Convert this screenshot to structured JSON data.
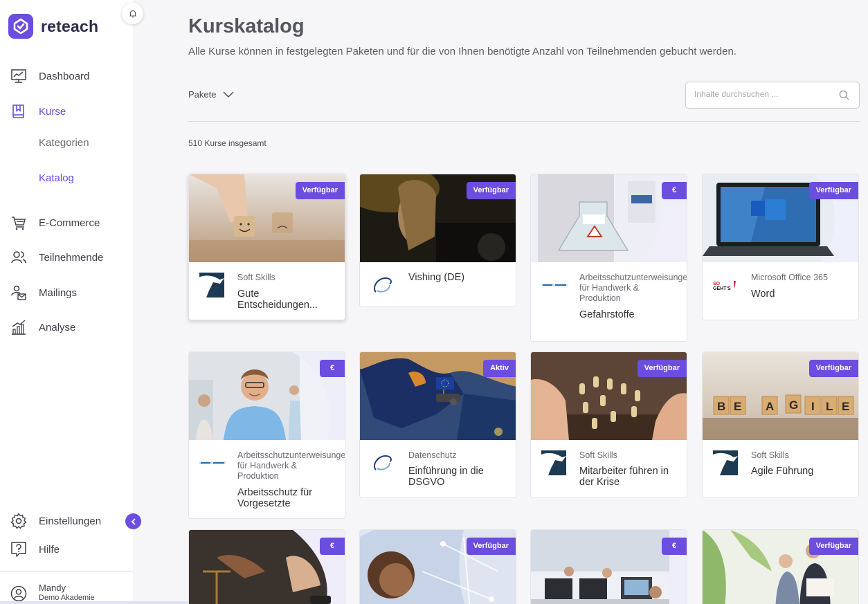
{
  "app": {
    "name": "reteach"
  },
  "sidebar": {
    "nav": [
      {
        "label": "Dashboard",
        "icon": "dashboard-icon"
      },
      {
        "label": "Kurse",
        "icon": "book-icon"
      },
      {
        "label": "E-Commerce",
        "icon": "cart-icon"
      },
      {
        "label": "Teilnehmende",
        "icon": "users-icon"
      },
      {
        "label": "Mailings",
        "icon": "mail-user-icon"
      },
      {
        "label": "Analyse",
        "icon": "chart-icon"
      }
    ],
    "sub": [
      {
        "label": "Kategorien"
      },
      {
        "label": "Katalog"
      }
    ],
    "bottom": [
      {
        "label": "Einstellungen",
        "icon": "gear-icon"
      },
      {
        "label": "Hilfe",
        "icon": "help-icon"
      }
    ],
    "user": {
      "name": "Mandy",
      "org": "Demo Akademie"
    }
  },
  "main": {
    "title": "Kurskatalog",
    "subtitle": "Alle Kurse können in festgelegten Paketen und für die von Ihnen benötigte Anzahl von Teilnehmenden gebucht werden.",
    "filter_label": "Pakete",
    "search_placeholder": "Inhalte durchsuchen ...",
    "count_text": "510 Kurse insgesamt"
  },
  "cards": [
    {
      "badge": "Verfügbar",
      "category": "Soft Skills",
      "title": "Gute Entscheidungen...",
      "provider": "eagle-logo"
    },
    {
      "badge": "Verfügbar",
      "category": "",
      "title": "Vishing (DE)",
      "provider": "swirl-logo"
    },
    {
      "badge": "€",
      "category": "Arbeitsschutzunterweisungen für Handwerk & Produktion",
      "title": "Gefahrstoffe",
      "provider": "text-logo"
    },
    {
      "badge": "Verfügbar",
      "category": "Microsoft Office 365",
      "title": "Word",
      "provider": "sogehts-logo"
    },
    {
      "badge": "€",
      "category": "Arbeitsschutzunterweisungen für Handwerk & Produktion",
      "title": "Arbeitsschutz für Vorgesetzte",
      "provider": "text-logo"
    },
    {
      "badge": "Aktiv",
      "category": "Datenschutz",
      "title": "Einführung in die DSGVO",
      "provider": "swirl-logo"
    },
    {
      "badge": "Verfügbar",
      "category": "Soft Skills",
      "title": "Mitarbeiter führen in der Krise",
      "provider": "eagle-logo"
    },
    {
      "badge": "Verfügbar",
      "category": "Soft Skills",
      "title": "Agile Führung",
      "provider": "eagle-logo"
    },
    {
      "badge": "€",
      "category": "",
      "title": "",
      "provider": ""
    },
    {
      "badge": "Verfügbar",
      "category": "",
      "title": "",
      "provider": ""
    },
    {
      "badge": "€",
      "category": "",
      "title": "",
      "provider": ""
    },
    {
      "badge": "Verfügbar",
      "category": "",
      "title": "",
      "provider": ""
    }
  ],
  "colors": {
    "accent": "#6b4de0",
    "text": "#3f3f4a",
    "background": "#f6f6f8"
  }
}
